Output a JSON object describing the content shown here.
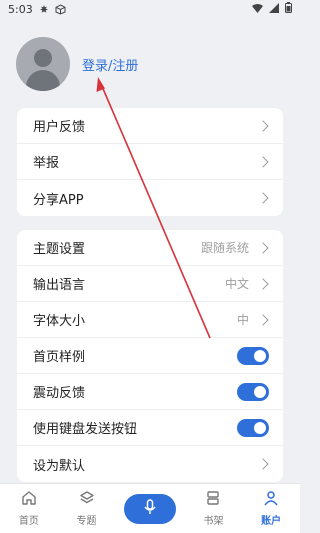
{
  "status_bar": {
    "time": "5:03",
    "icons": [
      "settings-icon",
      "cube-icon",
      "wifi-icon",
      "signal-icon",
      "battery-icon"
    ]
  },
  "profile": {
    "avatar_icon": "user-avatar-icon",
    "login_label": "登录/注册"
  },
  "group1": {
    "items": [
      {
        "label": "用户反馈"
      },
      {
        "label": "举报"
      },
      {
        "label": "分享APP"
      }
    ]
  },
  "group2": {
    "items": [
      {
        "label": "主题设置",
        "value": "跟随系统",
        "control": "chevron"
      },
      {
        "label": "输出语言",
        "value": "中文",
        "control": "chevron"
      },
      {
        "label": "字体大小",
        "value": "中",
        "control": "chevron"
      },
      {
        "label": "首页样例",
        "control": "toggle",
        "on": true
      },
      {
        "label": "震动反馈",
        "control": "toggle",
        "on": true
      },
      {
        "label": "使用键盘发送按钮",
        "control": "toggle",
        "on": true
      },
      {
        "label": "设为默认",
        "control": "chevron"
      }
    ]
  },
  "bottom_nav": {
    "items": [
      {
        "label": "首页",
        "icon": "home-icon"
      },
      {
        "label": "专题",
        "icon": "layers-icon"
      },
      {
        "label": "书架",
        "icon": "bookshelf-icon"
      },
      {
        "label": "账户",
        "icon": "account-icon",
        "active": true
      }
    ],
    "mic_icon": "microphone-icon"
  },
  "colors": {
    "accent": "#2f6fd9",
    "background": "#eef0f3",
    "annotation_arrow": "#d8323a"
  }
}
